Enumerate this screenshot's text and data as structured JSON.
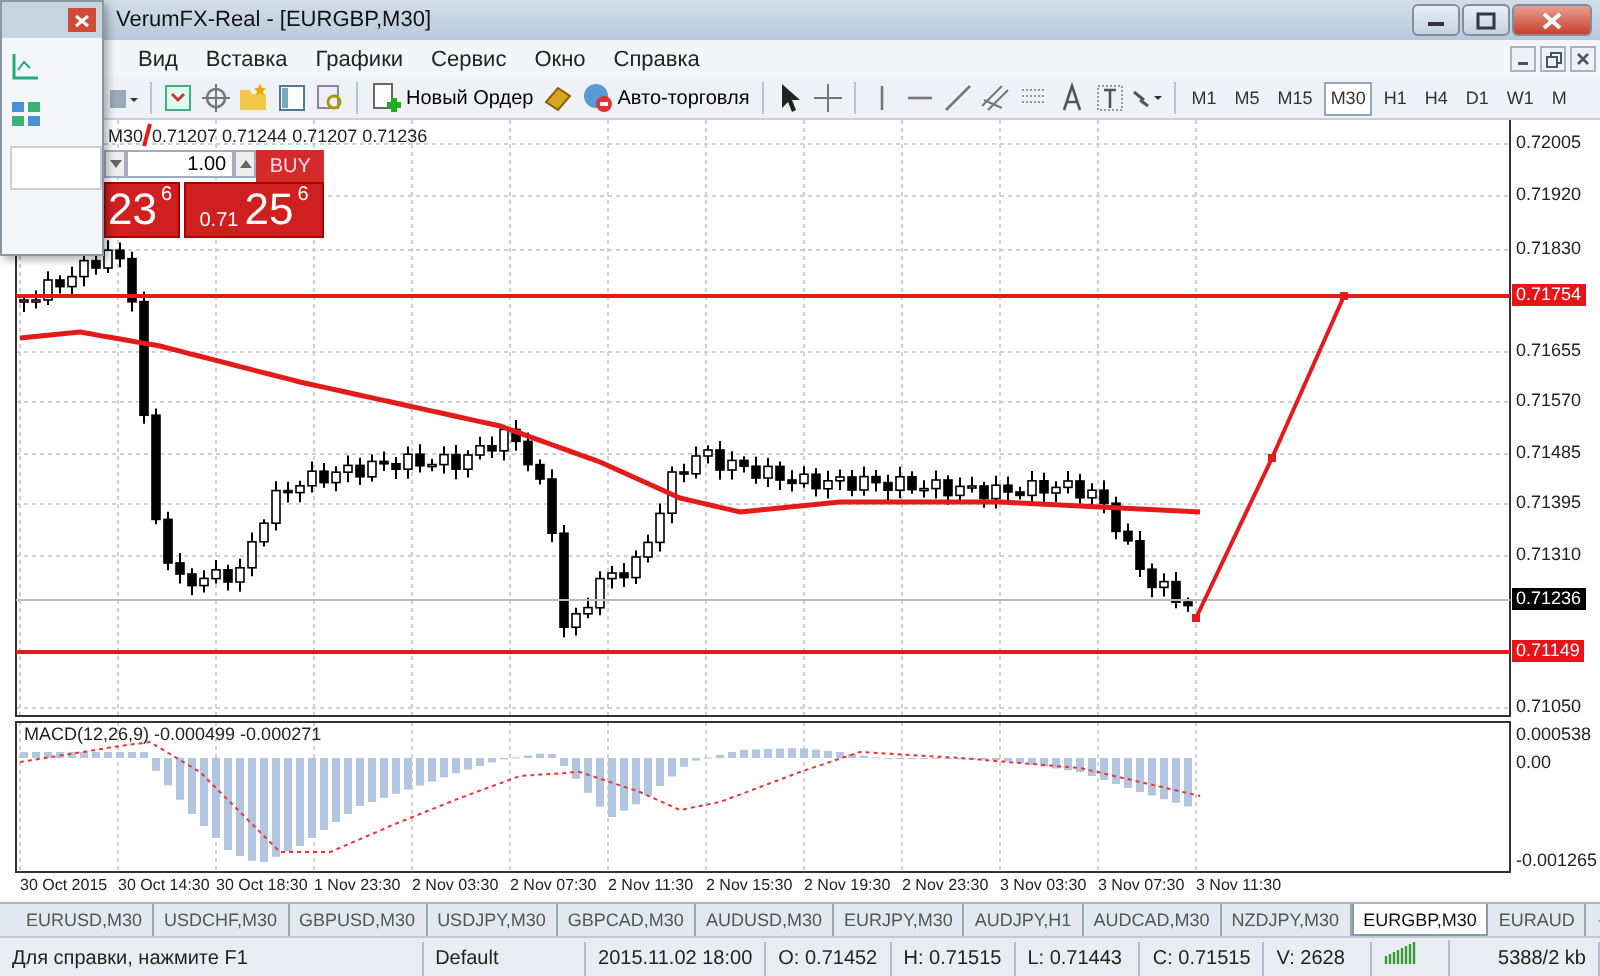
{
  "window": {
    "title": "VerumFX-Real - [EURGBP,M30]"
  },
  "menu": [
    "Вид",
    "Вставка",
    "Графики",
    "Сервис",
    "Окно",
    "Справка"
  ],
  "toolbar": [
    {
      "kind": "new_order",
      "label": "Новый Ордер"
    },
    {
      "kind": "auto_trading",
      "label": "Авто-торговля"
    }
  ],
  "timeframes": [
    {
      "label": "M1",
      "selected": false
    },
    {
      "label": "M5",
      "selected": false
    },
    {
      "label": "M15",
      "selected": false
    },
    {
      "label": "M30",
      "selected": true
    },
    {
      "label": "H1",
      "selected": false
    },
    {
      "label": "H4",
      "selected": false
    },
    {
      "label": "D1",
      "selected": false
    },
    {
      "label": "W1",
      "selected": false
    },
    {
      "label": "M",
      "selected": false
    }
  ],
  "chart": {
    "period": "M30",
    "ohlc": "0.71207 0.71244 0.71207 0.71236",
    "one_click": {
      "lot": "1.00",
      "buy_label": "BUY",
      "sell_price": {
        "big": "23",
        "pip": "6"
      },
      "buy_price": {
        "prefix": "0.71",
        "big": "25",
        "pip": "6"
      }
    },
    "price_axis": [
      {
        "text": "0.72005",
        "kind": "tick"
      },
      {
        "text": "0.71920",
        "kind": "tick"
      },
      {
        "text": "0.71830",
        "kind": "tick"
      },
      {
        "text": "0.71754",
        "kind": "line"
      },
      {
        "text": "0.71655",
        "kind": "tick"
      },
      {
        "text": "0.71570",
        "kind": "tick"
      },
      {
        "text": "0.71485",
        "kind": "tick"
      },
      {
        "text": "0.71395",
        "kind": "tick"
      },
      {
        "text": "0.71310",
        "kind": "tick"
      },
      {
        "text": "0.71236",
        "kind": "bid"
      },
      {
        "text": "0.71149",
        "kind": "line"
      },
      {
        "text": "0.71050",
        "kind": "tick"
      }
    ],
    "indicator": {
      "label": "MACD(12,26,9) -0.000499 -0.000271",
      "axis": [
        "0.000538",
        "0.00",
        "-0.001265"
      ]
    },
    "time_axis": [
      "30 Oct 2015",
      "30 Oct 14:30",
      "30 Oct 18:30",
      "1 Nov 23:30",
      "2 Nov 03:30",
      "2 Nov 07:30",
      "2 Nov 11:30",
      "2 Nov 15:30",
      "2 Nov 19:30",
      "2 Nov 23:30",
      "3 Nov 03:30",
      "3 Nov 07:30",
      "3 Nov 11:30"
    ]
  },
  "tabs": [
    {
      "label": "EURUSD,M30",
      "selected": false
    },
    {
      "label": "USDCHF,M30",
      "selected": false
    },
    {
      "label": "GBPUSD,M30",
      "selected": false
    },
    {
      "label": "USDJPY,M30",
      "selected": false
    },
    {
      "label": "GBPCAD,M30",
      "selected": false
    },
    {
      "label": "AUDUSD,M30",
      "selected": false
    },
    {
      "label": "EURJPY,M30",
      "selected": false
    },
    {
      "label": "AUDJPY,H1",
      "selected": false
    },
    {
      "label": "AUDCAD,M30",
      "selected": false
    },
    {
      "label": "NZDJPY,M30",
      "selected": false
    },
    {
      "label": "EURGBP,M30",
      "selected": true
    },
    {
      "label": "EURAUD",
      "selected": false
    }
  ],
  "status_bar": {
    "help": "Для справки, нажмите F1",
    "profile": "Default",
    "time": "2015.11.02 18:00",
    "open": "O: 0.71452",
    "high": "H: 0.71515",
    "low": "L: 0.71443",
    "close": "C: 0.71515",
    "volume": "V: 2628",
    "traffic": "5388/2 kb"
  }
}
